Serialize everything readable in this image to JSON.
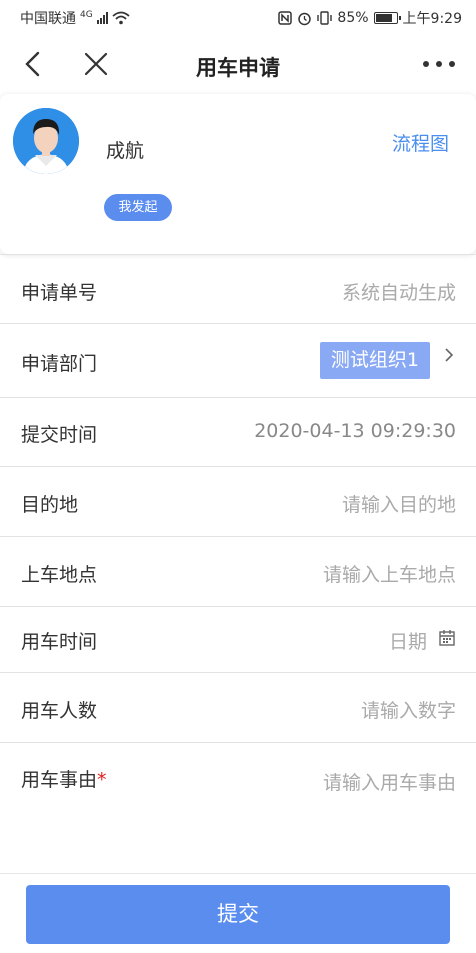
{
  "status_bar": {
    "carrier": "中国联通",
    "network": "4G",
    "battery": "85%",
    "battery_level": 0.85,
    "time": "上午9:29"
  },
  "navbar": {
    "title": "用车申请",
    "back_icon": "chevron-left-icon",
    "close_icon": "close-icon",
    "more_icon": "more-horizontal-icon"
  },
  "applicant": {
    "name": "成航",
    "flow_link": "流程图",
    "badge": "我发起"
  },
  "form": {
    "rows": [
      {
        "label": "申请单号",
        "value": "系统自动生成"
      },
      {
        "label": "申请部门",
        "value": "测试组织1"
      },
      {
        "label": "提交时间",
        "value": "2020-04-13 09:29:30"
      },
      {
        "label": "目的地",
        "placeholder": "请输入目的地"
      },
      {
        "label": "上车地点",
        "placeholder": "请输入上车地点"
      },
      {
        "label": "用车时间",
        "placeholder": "日期"
      },
      {
        "label": "用车人数",
        "placeholder": "请输入数字"
      },
      {
        "label": "用车事由",
        "required_mark": "*",
        "placeholder": "请输入用车事由"
      }
    ]
  },
  "submit_label": "提交",
  "colors": {
    "accent": "#5b8def",
    "dept_tag": "#8aa9f5",
    "link": "#4a8ef0",
    "required": "#e02020"
  }
}
